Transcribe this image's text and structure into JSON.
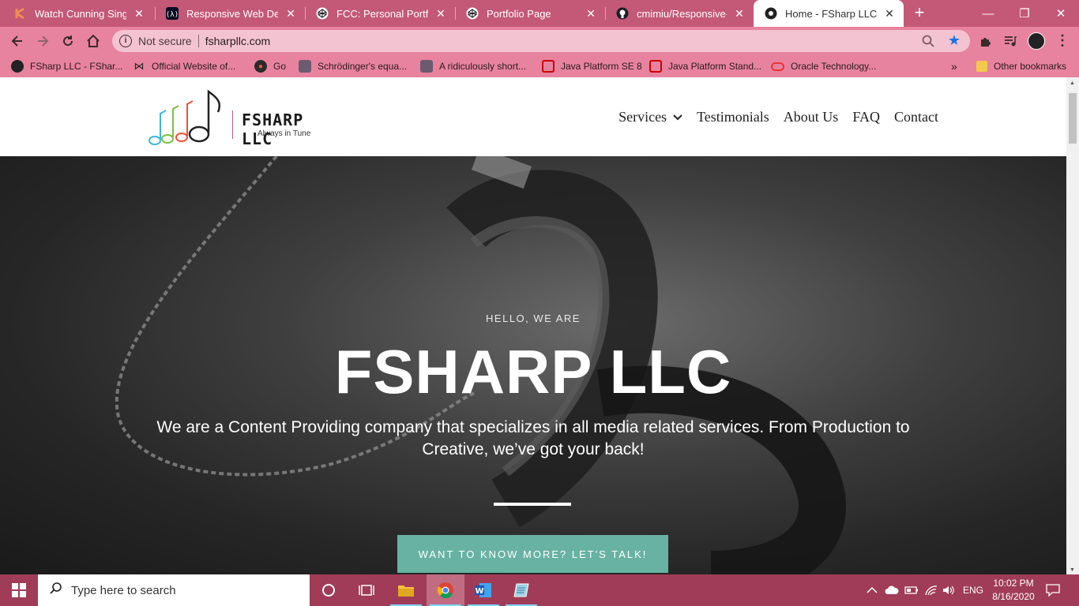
{
  "browser": {
    "tabs": [
      {
        "title": "Watch Cunning Single L",
        "icon": "kanopy-icon",
        "active": false
      },
      {
        "title": "Responsive Web Design",
        "icon": "freecodecamp-icon",
        "active": false
      },
      {
        "title": "FCC: Personal Portfolio",
        "icon": "codepen-icon",
        "active": false
      },
      {
        "title": "Portfolio Page",
        "icon": "codepen-icon",
        "active": false
      },
      {
        "title": "cmimiu/Responsive-We",
        "icon": "github-icon",
        "active": false
      },
      {
        "title": "Home - FSharp LLC",
        "icon": "fsharp-icon",
        "active": true
      }
    ],
    "address": {
      "security_label": "Not secure",
      "url": "fsharpllc.com"
    },
    "bookmarks": [
      {
        "label": "FSharp LLC - FShar...",
        "icon": "fsharp-icon"
      },
      {
        "label": "Official Website of...",
        "icon": "ribbon-icon"
      },
      {
        "label": "Go",
        "icon": "go-icon"
      },
      {
        "label": "Schrödinger's equa...",
        "icon": "photo-icon"
      },
      {
        "label": "A ridiculously short...",
        "icon": "photo-icon"
      },
      {
        "label": "Java Platform SE 8",
        "icon": "oracle-icon"
      },
      {
        "label": "Java Platform Stand...",
        "icon": "oracle-icon"
      },
      {
        "label": "Oracle Technology...",
        "icon": "oracle-ring-icon"
      }
    ],
    "bookmarks_overflow": "»",
    "other_bookmarks": "Other bookmarks",
    "colors": {
      "frame": "#c45877",
      "toolbar": "#e8839f"
    }
  },
  "site": {
    "logo": {
      "name": "FSHARP LLC",
      "tagline": "Always in Tune"
    },
    "nav": [
      "Services",
      "Testimonials",
      "About Us",
      "FAQ",
      "Contact"
    ],
    "hero": {
      "kicker": "HELLO, WE ARE",
      "title": "FSHARP LLC",
      "description": "We are a Content Providing company that specializes in all media related services. From Production to Creative, we’ve got your back!",
      "cta": "WANT TO KNOW MORE? LET'S TALK!"
    },
    "colors": {
      "cta": "#67b2a3"
    }
  },
  "taskbar": {
    "search_placeholder": "Type here to search",
    "apps": [
      "cortana-icon",
      "task-view-icon",
      "file-explorer-icon",
      "chrome-icon",
      "word-icon",
      "notepad-icon"
    ],
    "language": "ENG",
    "time": "10:02 PM",
    "date": "8/16/2020"
  }
}
